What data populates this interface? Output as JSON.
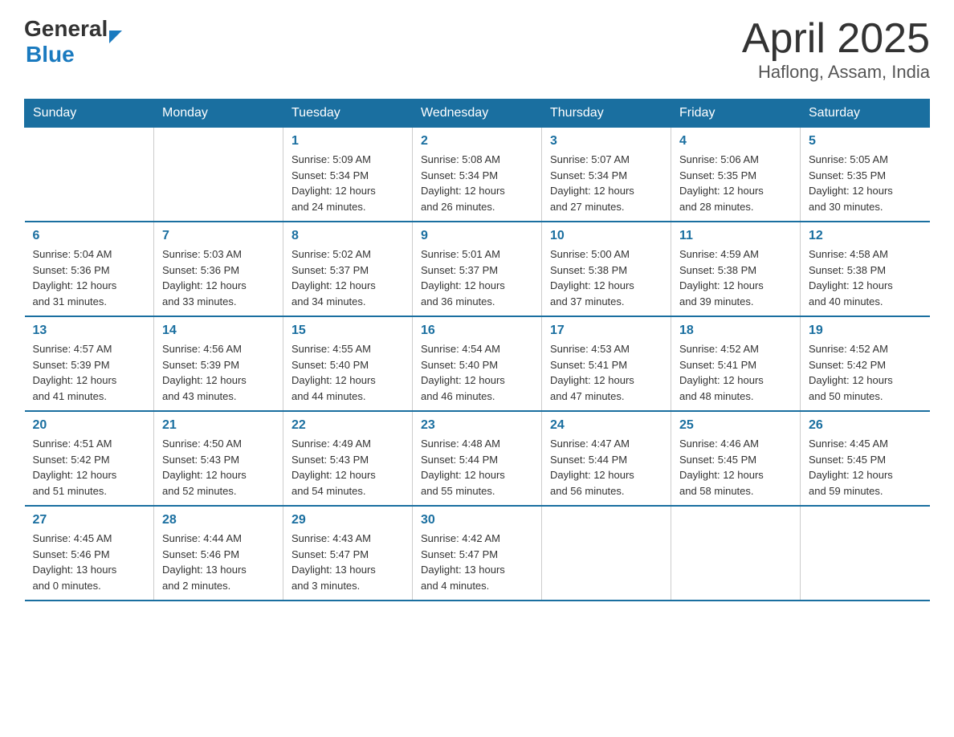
{
  "logo": {
    "general": "General",
    "triangle": "▶",
    "blue": "Blue"
  },
  "title": "April 2025",
  "subtitle": "Haflong, Assam, India",
  "days_header": [
    "Sunday",
    "Monday",
    "Tuesday",
    "Wednesday",
    "Thursday",
    "Friday",
    "Saturday"
  ],
  "weeks": [
    [
      {
        "day": "",
        "info": ""
      },
      {
        "day": "",
        "info": ""
      },
      {
        "day": "1",
        "info": "Sunrise: 5:09 AM\nSunset: 5:34 PM\nDaylight: 12 hours\nand 24 minutes."
      },
      {
        "day": "2",
        "info": "Sunrise: 5:08 AM\nSunset: 5:34 PM\nDaylight: 12 hours\nand 26 minutes."
      },
      {
        "day": "3",
        "info": "Sunrise: 5:07 AM\nSunset: 5:34 PM\nDaylight: 12 hours\nand 27 minutes."
      },
      {
        "day": "4",
        "info": "Sunrise: 5:06 AM\nSunset: 5:35 PM\nDaylight: 12 hours\nand 28 minutes."
      },
      {
        "day": "5",
        "info": "Sunrise: 5:05 AM\nSunset: 5:35 PM\nDaylight: 12 hours\nand 30 minutes."
      }
    ],
    [
      {
        "day": "6",
        "info": "Sunrise: 5:04 AM\nSunset: 5:36 PM\nDaylight: 12 hours\nand 31 minutes."
      },
      {
        "day": "7",
        "info": "Sunrise: 5:03 AM\nSunset: 5:36 PM\nDaylight: 12 hours\nand 33 minutes."
      },
      {
        "day": "8",
        "info": "Sunrise: 5:02 AM\nSunset: 5:37 PM\nDaylight: 12 hours\nand 34 minutes."
      },
      {
        "day": "9",
        "info": "Sunrise: 5:01 AM\nSunset: 5:37 PM\nDaylight: 12 hours\nand 36 minutes."
      },
      {
        "day": "10",
        "info": "Sunrise: 5:00 AM\nSunset: 5:38 PM\nDaylight: 12 hours\nand 37 minutes."
      },
      {
        "day": "11",
        "info": "Sunrise: 4:59 AM\nSunset: 5:38 PM\nDaylight: 12 hours\nand 39 minutes."
      },
      {
        "day": "12",
        "info": "Sunrise: 4:58 AM\nSunset: 5:38 PM\nDaylight: 12 hours\nand 40 minutes."
      }
    ],
    [
      {
        "day": "13",
        "info": "Sunrise: 4:57 AM\nSunset: 5:39 PM\nDaylight: 12 hours\nand 41 minutes."
      },
      {
        "day": "14",
        "info": "Sunrise: 4:56 AM\nSunset: 5:39 PM\nDaylight: 12 hours\nand 43 minutes."
      },
      {
        "day": "15",
        "info": "Sunrise: 4:55 AM\nSunset: 5:40 PM\nDaylight: 12 hours\nand 44 minutes."
      },
      {
        "day": "16",
        "info": "Sunrise: 4:54 AM\nSunset: 5:40 PM\nDaylight: 12 hours\nand 46 minutes."
      },
      {
        "day": "17",
        "info": "Sunrise: 4:53 AM\nSunset: 5:41 PM\nDaylight: 12 hours\nand 47 minutes."
      },
      {
        "day": "18",
        "info": "Sunrise: 4:52 AM\nSunset: 5:41 PM\nDaylight: 12 hours\nand 48 minutes."
      },
      {
        "day": "19",
        "info": "Sunrise: 4:52 AM\nSunset: 5:42 PM\nDaylight: 12 hours\nand 50 minutes."
      }
    ],
    [
      {
        "day": "20",
        "info": "Sunrise: 4:51 AM\nSunset: 5:42 PM\nDaylight: 12 hours\nand 51 minutes."
      },
      {
        "day": "21",
        "info": "Sunrise: 4:50 AM\nSunset: 5:43 PM\nDaylight: 12 hours\nand 52 minutes."
      },
      {
        "day": "22",
        "info": "Sunrise: 4:49 AM\nSunset: 5:43 PM\nDaylight: 12 hours\nand 54 minutes."
      },
      {
        "day": "23",
        "info": "Sunrise: 4:48 AM\nSunset: 5:44 PM\nDaylight: 12 hours\nand 55 minutes."
      },
      {
        "day": "24",
        "info": "Sunrise: 4:47 AM\nSunset: 5:44 PM\nDaylight: 12 hours\nand 56 minutes."
      },
      {
        "day": "25",
        "info": "Sunrise: 4:46 AM\nSunset: 5:45 PM\nDaylight: 12 hours\nand 58 minutes."
      },
      {
        "day": "26",
        "info": "Sunrise: 4:45 AM\nSunset: 5:45 PM\nDaylight: 12 hours\nand 59 minutes."
      }
    ],
    [
      {
        "day": "27",
        "info": "Sunrise: 4:45 AM\nSunset: 5:46 PM\nDaylight: 13 hours\nand 0 minutes."
      },
      {
        "day": "28",
        "info": "Sunrise: 4:44 AM\nSunset: 5:46 PM\nDaylight: 13 hours\nand 2 minutes."
      },
      {
        "day": "29",
        "info": "Sunrise: 4:43 AM\nSunset: 5:47 PM\nDaylight: 13 hours\nand 3 minutes."
      },
      {
        "day": "30",
        "info": "Sunrise: 4:42 AM\nSunset: 5:47 PM\nDaylight: 13 hours\nand 4 minutes."
      },
      {
        "day": "",
        "info": ""
      },
      {
        "day": "",
        "info": ""
      },
      {
        "day": "",
        "info": ""
      }
    ]
  ]
}
